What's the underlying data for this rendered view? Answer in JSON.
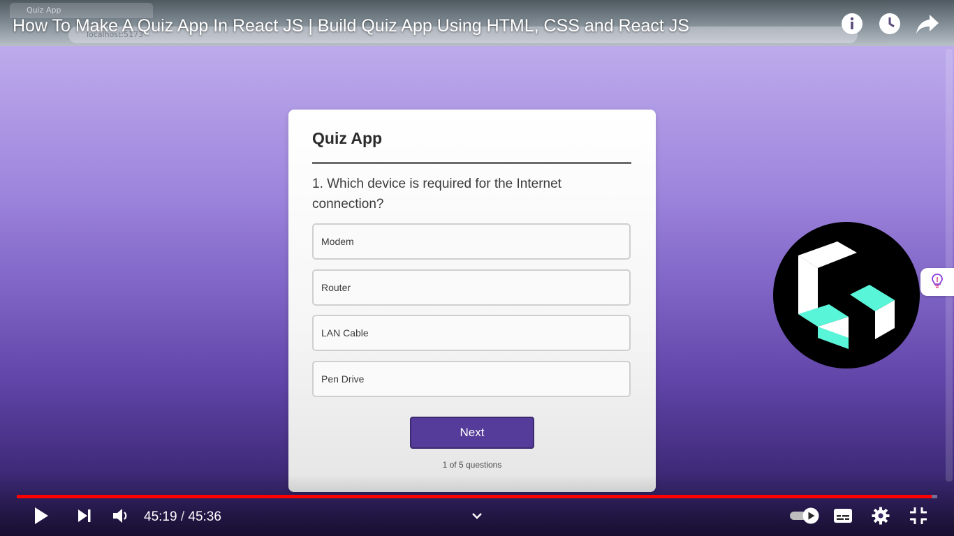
{
  "browser": {
    "tab_title": "Quiz App",
    "url": "localhost:5173"
  },
  "video": {
    "title": "How To Make A Quiz App In React JS | Build Quiz App Using HTML, CSS and React JS",
    "current_time": "45:19",
    "duration": "45:36",
    "time_separator": "/",
    "progress_fraction": 0.994,
    "accent_color": "#ff0000"
  },
  "quiz": {
    "title": "Quiz App",
    "question": "1. Which device is required for the Internet connection?",
    "options": [
      "Modem",
      "Router",
      "LAN Cable",
      "Pen Drive"
    ],
    "next_label": "Next",
    "progress_text": "1 of 5 questions",
    "button_color": "#553c9a"
  },
  "icons": {
    "info": "info-icon",
    "watch_later": "clock-icon",
    "share": "share-icon",
    "play": "play-icon",
    "next": "skip-next-icon",
    "volume": "volume-icon",
    "chevron": "chevron-down-icon",
    "autoplay": "autoplay-toggle-icon",
    "captions": "captions-icon",
    "settings": "gear-icon",
    "fullscreen_exit": "exit-fullscreen-icon",
    "logo": "channel-logo-icon",
    "bulb": "lightbulb-icon"
  }
}
